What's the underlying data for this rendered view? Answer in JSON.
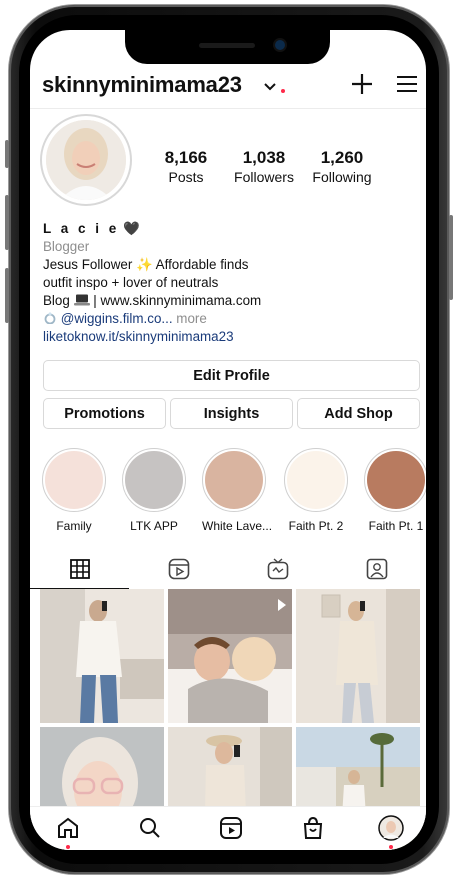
{
  "header": {
    "username": "skinnyminimama23"
  },
  "stats": [
    {
      "value": "8,166",
      "label": "Posts"
    },
    {
      "value": "1,038",
      "label": "Followers"
    },
    {
      "value": "1,260",
      "label": "Following"
    }
  ],
  "bio": {
    "name": "L a c i e",
    "name_emoji": "🖤",
    "category": "Blogger",
    "line1": "Jesus Follower ✨ Affordable finds",
    "line2": "outfit inspo + lover of neutrals",
    "line3_prefix": "Blog",
    "line3_suffix": "| www.skinnyminimama.com",
    "line4_mention": "@wiggins.film.co...",
    "line4_more": "more",
    "link": "liketoknow.it/skinnyminimama23"
  },
  "buttons": {
    "edit_profile": "Edit Profile",
    "promotions": "Promotions",
    "insights": "Insights",
    "add_shop": "Add Shop"
  },
  "highlights": [
    {
      "label": "Family",
      "color": "#f5e1da"
    },
    {
      "label": "LTK APP",
      "color": "#c6c3c2"
    },
    {
      "label": "White Lave...",
      "color": "#d9b4a0"
    },
    {
      "label": "Faith Pt. 2",
      "color": "#fbf3ea"
    },
    {
      "label": "Faith Pt. 1",
      "color": "#b87b60"
    }
  ],
  "colors": {
    "accent_red": "#ff2a4a",
    "link_blue": "#1a3b7a",
    "muted": "#8e8e8e"
  }
}
